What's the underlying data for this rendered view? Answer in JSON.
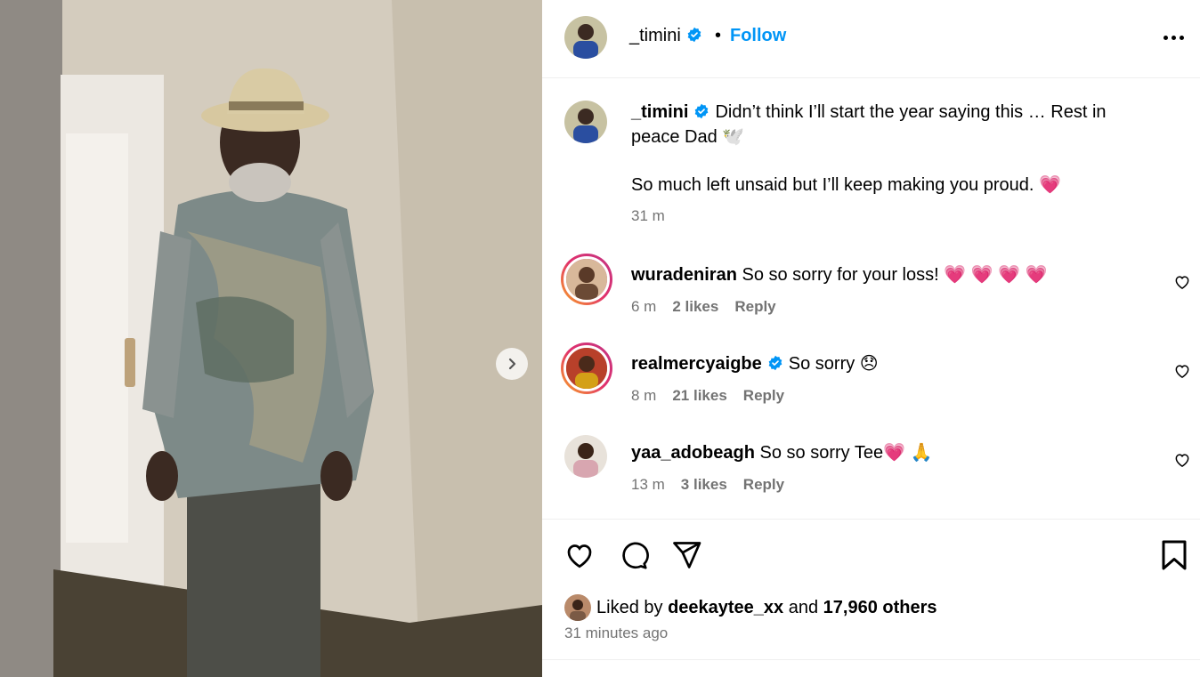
{
  "post": {
    "username": "_timini",
    "follow_label": "Follow",
    "separator": "•",
    "caption_line1": "Didn’t think I’ll start the year saying this … Rest in peace Dad 🕊️",
    "caption_line2": "So much left unsaid but I’ll keep making you proud. 💗",
    "caption_time": "31 m"
  },
  "comments": [
    {
      "username": "wuradeniran",
      "text": "So so sorry for your loss! 💗 💗 💗 💗",
      "time": "6 m",
      "likes": "2 likes",
      "reply": "Reply",
      "verified": false
    },
    {
      "username": "realmercyaigbe",
      "text": "So sorry 😞",
      "time": "8 m",
      "likes": "21 likes",
      "reply": "Reply",
      "verified": true
    },
    {
      "username": "yaa_adobeagh",
      "text": "So so sorry Tee💗 🙏",
      "time": "13 m",
      "likes": "3 likes",
      "reply": "Reply",
      "verified": false
    }
  ],
  "likes": {
    "prefix": "Liked by",
    "user": "deekaytee_xx",
    "and": "and",
    "others": "17,960 others"
  },
  "posted_ago": "31 minutes ago",
  "colors": {
    "accent": "#0095f6",
    "muted": "#737373",
    "verified": "#0095f6"
  },
  "icons": [
    "verified-badge-icon",
    "more-options-icon",
    "heart-icon",
    "comment-icon",
    "share-icon",
    "bookmark-icon",
    "chevron-right-icon"
  ]
}
